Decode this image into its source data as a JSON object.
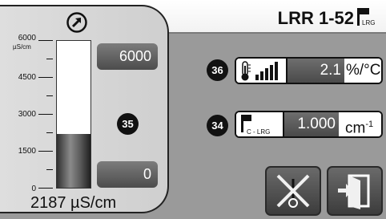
{
  "header": {
    "device_name": "LRR 1-52",
    "device_tag": "LRG"
  },
  "gauge": {
    "scale": {
      "max_label": "6000",
      "unit_label": "µS/cm",
      "ticks": [
        "6000",
        "4500",
        "3000",
        "1500",
        "0"
      ]
    },
    "current_value": "2187 µS/cm",
    "fill_fraction": 0.3645,
    "upper_limit": "6000",
    "lower_limit": "0",
    "badge": "35"
  },
  "params": [
    {
      "badge": "36",
      "icon": "thermometer-signal-icon",
      "value": "2.1",
      "unit": "%/°C"
    },
    {
      "badge": "34",
      "icon": "cell-constant-flag-icon",
      "icon_label": "C - LRG",
      "value": "1.000",
      "unit": "cm",
      "unit_superscript": "-1"
    }
  ],
  "colors": {
    "background": "#9a9a9a",
    "panel": "#d6d6d6",
    "value_box": "#5a5a5a",
    "badge": "#111111"
  }
}
